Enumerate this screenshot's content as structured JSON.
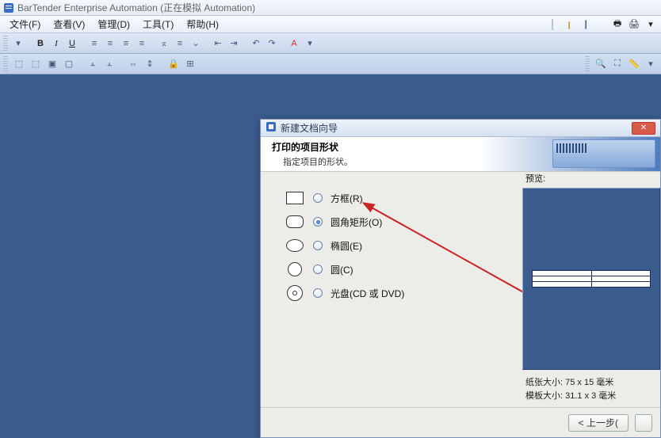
{
  "app": {
    "title": "BarTender Enterprise Automation (正在模拟 Automation)"
  },
  "menu": {
    "file": "文件(F)",
    "view": "查看(V)",
    "manage": "管理(D)",
    "tools": "工具(T)",
    "help": "帮助(H)"
  },
  "toolbar_row1": {
    "icons": [
      "new",
      "open",
      "save",
      "print",
      "sep"
    ]
  },
  "dialog": {
    "title": "新建文档向导",
    "heading": "打印的项目形状",
    "subheading": "指定项目的形状。",
    "options": {
      "box": {
        "label": "方框(R)",
        "checked": false
      },
      "rounded": {
        "label": "圆角矩形(O)",
        "checked": true
      },
      "ellipse": {
        "label": "椭圆(E)",
        "checked": false
      },
      "circle": {
        "label": "圆(C)",
        "checked": false
      },
      "cd": {
        "label": "光盘(CD 或 DVD)",
        "checked": false
      }
    },
    "preview_label": "预览:",
    "paper_size": "纸张大小:  75 x 15 毫米",
    "template_size": "模板大小:  31.1 x 3 毫米",
    "back_btn": "< 上一步("
  }
}
